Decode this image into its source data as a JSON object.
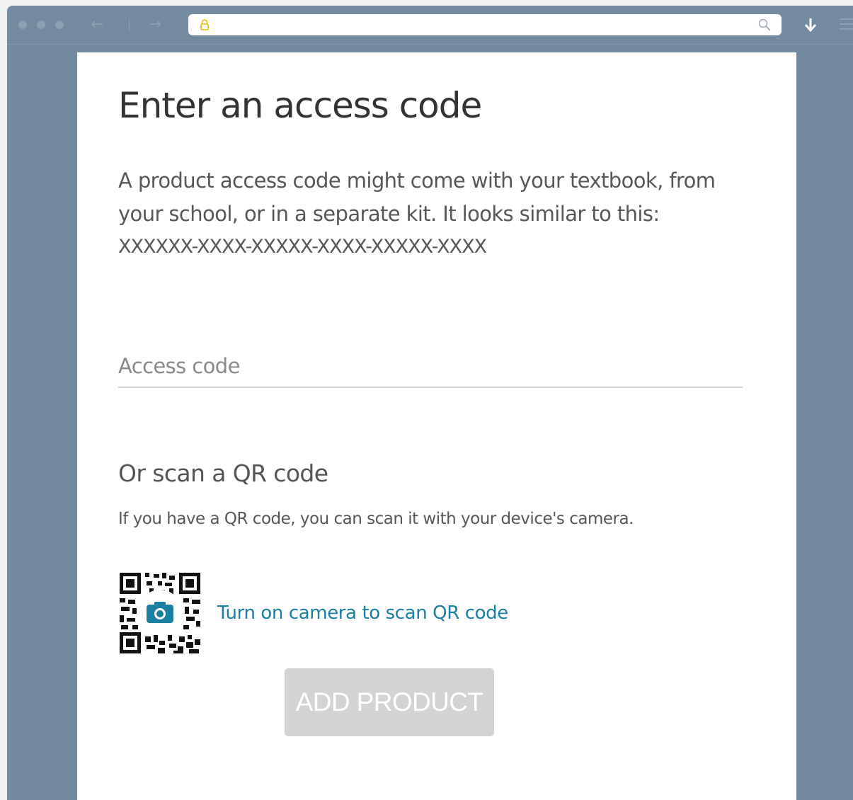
{
  "browser": {
    "url": "",
    "icons": [
      "lock-icon",
      "search-icon",
      "download-icon",
      "menu-icon",
      "back-icon",
      "forward-icon"
    ]
  },
  "page": {
    "title": "Enter an access code",
    "description": "A product access code might come with your textbook, from your school, or in a separate kit. It looks similar to this:",
    "sample_code": "XXXXXX-XXXX-XXXXX-XXXX-XXXXX-XXXX",
    "access_code_field": {
      "placeholder": "Access code",
      "value": ""
    },
    "qr": {
      "title": "Or scan a QR code",
      "description": "If you have a QR code, you can scan it with your device's camera.",
      "link_label": "Turn on camera to scan QR code"
    },
    "submit_label": "ADD PRODUCT"
  },
  "colors": {
    "window_chrome": "#728ba1",
    "link": "#1a7fa0",
    "disabled_button": "#d3d3d3",
    "lock_icon": "#e8c000"
  }
}
